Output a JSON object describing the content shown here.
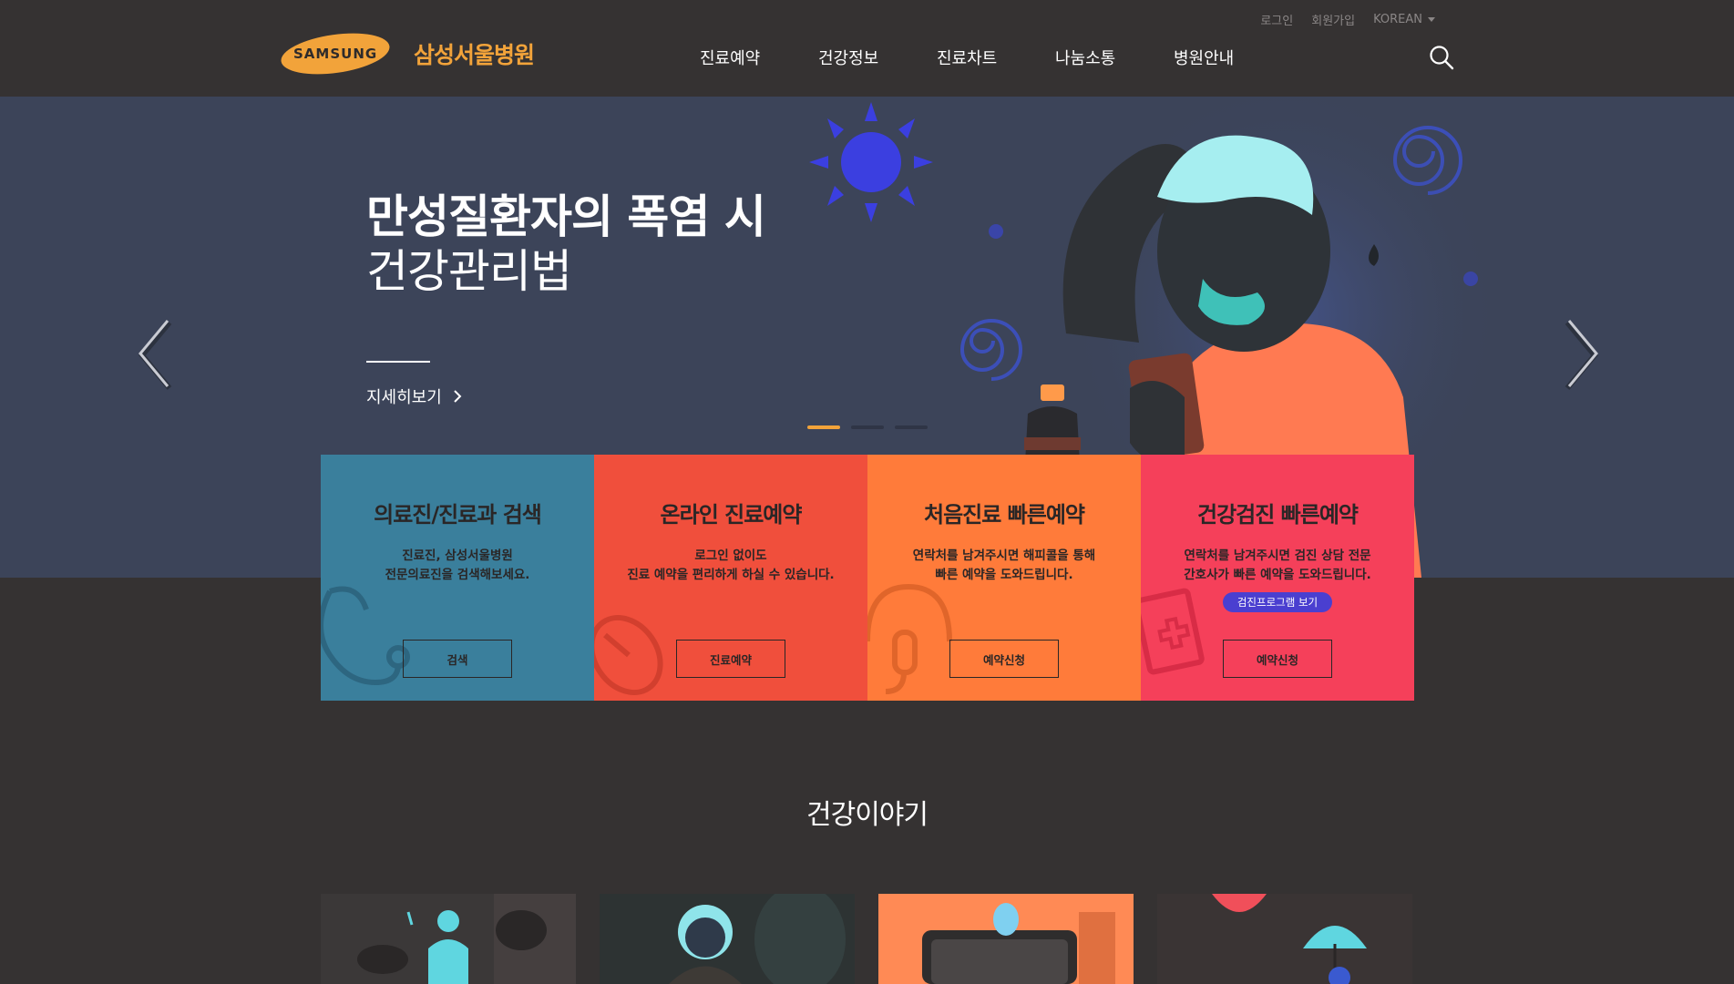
{
  "header": {
    "util": {
      "login": "로그인",
      "join": "회원가입",
      "lang": "KOREAN"
    },
    "logo": {
      "brand": "SAMSUNG",
      "name": "삼성서울병원"
    },
    "nav": [
      "진료예약",
      "건강정보",
      "진료차트",
      "나눔소통",
      "병원안내"
    ],
    "icons": {
      "search": "search-icon",
      "caret": "caret-down-icon"
    }
  },
  "hero": {
    "title_line1": "만성질환자의 폭염 시",
    "title_line2": "건강관리법",
    "more_label": "지세히보기",
    "slides": 3,
    "active_slide": 1,
    "icons": {
      "prev": "chevron-left-icon",
      "next": "chevron-right-icon",
      "more": "chevron-right-icon"
    }
  },
  "cards": [
    {
      "title": "의료진/진료과 검색",
      "desc": "진료진, 삼성서울병원\n전문의료진을 검색해보세요.",
      "button": "검색",
      "color": "#3a7f9c",
      "icon": "stethoscope-icon"
    },
    {
      "title": "온라인 진료예약",
      "desc": "로그인 없이도\n진료 예약을 편리하게 하실 수 있습니다.",
      "button": "진료예약",
      "color": "#f04f3c",
      "icon": "mouse-icon"
    },
    {
      "title": "처음진료 빠른예약",
      "desc": "연락처를 남겨주시면 해피콜을 통해\n빠른 예약을 도와드립니다.",
      "button": "예약신청",
      "color": "#ff7b3a",
      "icon": "headset-icon"
    },
    {
      "title": "건강검진 빠른예약",
      "desc": "연락처를 남겨주시면 검진 상담 전문\n간호사가 빠른 예약을 도와드립니다.",
      "button": "예약신청",
      "pill": "검진프로그램 보기",
      "color": "#f5405a",
      "icon": "medical-chart-icon"
    }
  ],
  "story": {
    "title": "건강이야기"
  },
  "colors": {
    "background": "#353232",
    "hero": "#3c4459",
    "accent": "#f2a33a"
  }
}
